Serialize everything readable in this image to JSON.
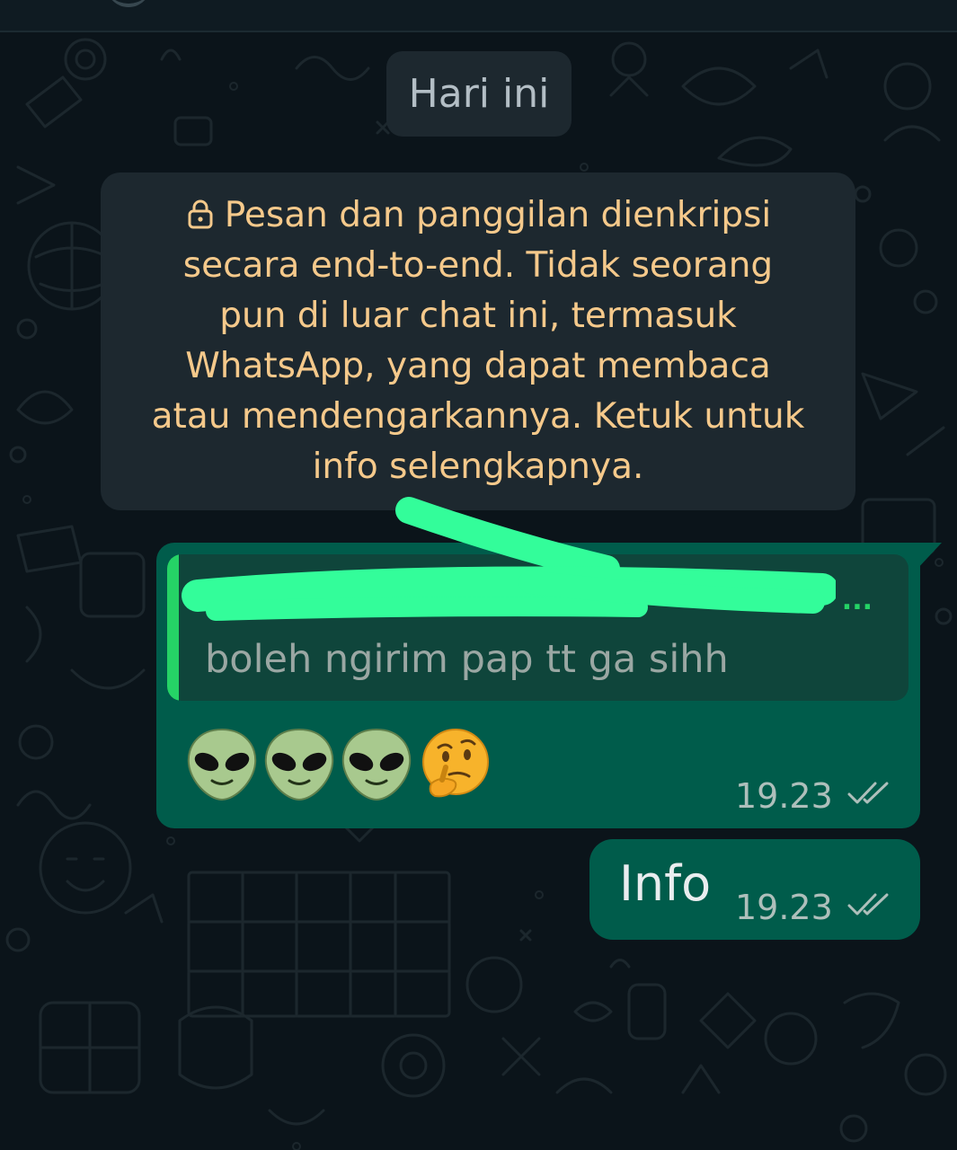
{
  "date_chip": "Hari ini",
  "encryption_notice": {
    "lines": [
      "Pesan dan panggilan dienkripsi",
      "secara end-to-end. Tidak seorang",
      "pun di luar chat ini, termasuk",
      "WhatsApp, yang dapat membaca",
      "atau mendengarkannya. Ketuk untuk",
      "info selengkapnya."
    ],
    "icon": "lock-icon"
  },
  "messages": [
    {
      "direction": "outgoing",
      "quoted": {
        "author": "...",
        "author_redacted": true,
        "text": "boleh ngirim pap tt ga sihh"
      },
      "emojis": [
        "alien",
        "alien",
        "alien",
        "thinking-face"
      ],
      "time": "19.23",
      "status": "double-check-icon"
    },
    {
      "direction": "outgoing",
      "text": "Info",
      "time": "19.23",
      "status": "double-check-icon"
    }
  ],
  "colors": {
    "background": "#0b141a",
    "system_bubble": "#1d282f",
    "notice_text": "#f5c98b",
    "outgoing_bubble": "#005c4b",
    "quote_background": "#0f453b",
    "quote_accent": "#25d366",
    "redaction_stroke": "#33fd9a"
  }
}
